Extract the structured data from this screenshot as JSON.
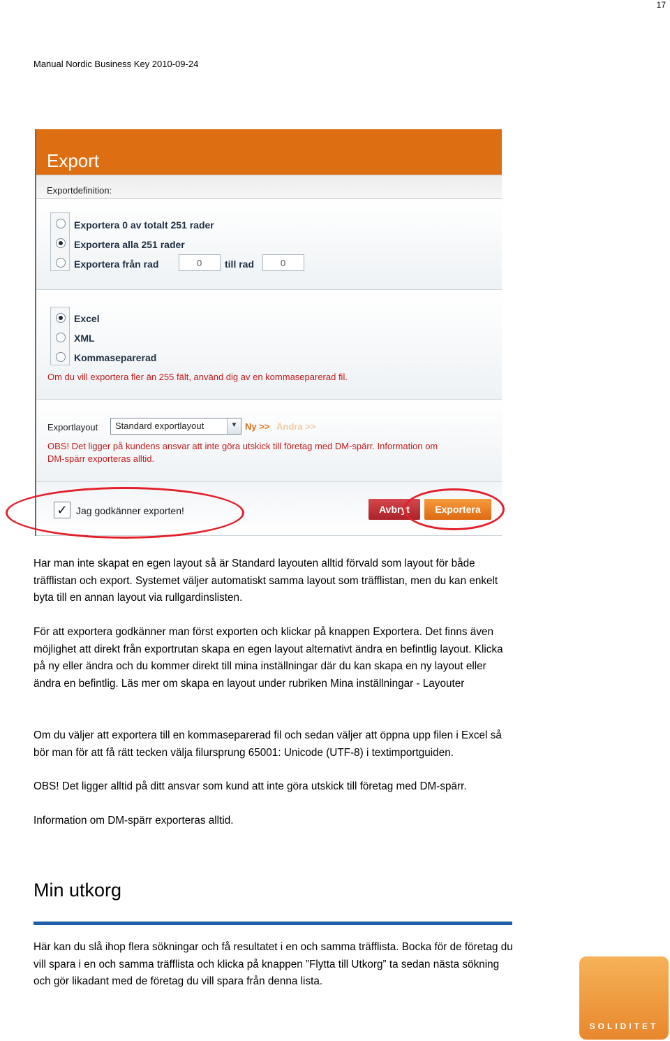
{
  "page": {
    "number": "17",
    "header": "Manual Nordic Business Key 2010-09-24"
  },
  "dialog": {
    "title": "Export",
    "subheading": "Exportdefinition:",
    "range_options": [
      {
        "label": "Exportera 0 av totalt 251 rader",
        "selected": false
      },
      {
        "label": "Exportera alla 251 rader",
        "selected": true
      },
      {
        "label": "Exportera från rad",
        "selected": false
      }
    ],
    "from_row_value": "0",
    "to_row_label": "till rad",
    "to_row_value": "0",
    "format_options": [
      {
        "label": "Excel",
        "selected": true
      },
      {
        "label": "XML",
        "selected": false
      },
      {
        "label": "Kommaseparerad",
        "selected": false
      }
    ],
    "format_hint": "Om du vill exportera fler än 255 fält, använd dig av en kommaseparerad fil.",
    "layout_label": "Exportlayout",
    "layout_selected": "Standard exportlayout",
    "link_new": "Ny >>",
    "link_edit": "Ändra >>",
    "dm_warning_line1": "OBS! Det ligger på kundens ansvar att inte göra utskick till företag med DM-spärr. Information om",
    "dm_warning_line2": "DM-spärr exporteras alltid.",
    "approve_label": "Jag godkänner exporten!",
    "approve_checked": true,
    "cancel_button": "Avbryt",
    "export_button": "Exportera",
    "accent_color": "#de6e12"
  },
  "body": {
    "para1": "Har man inte skapat en egen layout så är Standard layouten alltid förvald som layout för både träfflistan och export. Systemet väljer automatiskt samma layout som träfflistan, men du kan enkelt byta till en annan layout via rullgardinslisten.",
    "para2": "För att exportera godkänner man först exporten och klickar på knappen Exportera. Det finns även möjlighet att direkt från exportrutan skapa en egen layout alternativt ändra en befintlig layout. Klicka på ny eller ändra och du kommer direkt till mina inställningar där du kan skapa en ny layout eller ändra en befintlig. Läs mer om skapa en layout under rubriken Mina inställningar - Layouter",
    "para3a": "Om du väljer att exportera till en kommaseparerad fil och sedan väljer att öppna upp filen i Excel så bör man för att få rätt tecken välja filursprung 65001: Unicode (UTF-8) i textimportguiden.",
    "para3b": "OBS! Det ligger alltid på ditt ansvar som kund att inte göra utskick till företag med DM-spärr.",
    "para3c": "Information om DM-spärr exporteras alltid."
  },
  "section": {
    "heading": "Min utkorg",
    "text": "Här kan du slå ihop flera sökningar och få resultatet i en och samma träfflista. Bocka för de företag du vill spara i en och samma träfflista och klicka på knappen ”Flytta till Utkorg” ta sedan nästa sökning och gör likadant med de företag du vill spara från denna lista."
  },
  "logo": {
    "text": "SOLIDITET",
    "color": "#e8872c"
  }
}
